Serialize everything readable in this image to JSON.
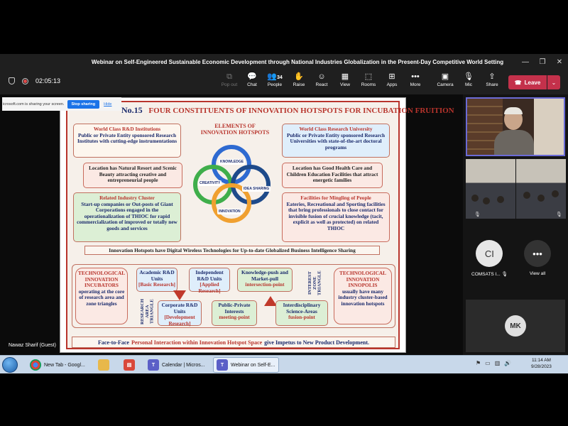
{
  "window": {
    "title": "Webinar on Self-Engineered Sustainable Economic Development through National Industries Globalization in the Present-Day Competitive World Setting"
  },
  "toolbar": {
    "timer": "02:05:13",
    "buttons": [
      {
        "label": "Pop out",
        "icon": "popout-icon"
      },
      {
        "label": "Chat",
        "icon": "chat-icon"
      },
      {
        "label": "People",
        "icon": "people-icon",
        "count": "34"
      },
      {
        "label": "Raise",
        "icon": "hand-icon"
      },
      {
        "label": "React",
        "icon": "smile-icon"
      },
      {
        "label": "View",
        "icon": "view-icon"
      },
      {
        "label": "Rooms",
        "icon": "rooms-icon"
      },
      {
        "label": "Apps",
        "icon": "apps-icon"
      },
      {
        "label": "More",
        "icon": "more-icon"
      },
      {
        "label": "Camera",
        "icon": "camera-off-icon"
      },
      {
        "label": "Mic",
        "icon": "mic-off-icon"
      },
      {
        "label": "Share",
        "icon": "share-icon"
      }
    ],
    "leave_label": "Leave"
  },
  "sharing": {
    "notice": "icrosoft.com is sharing your screen.",
    "stop_label": "Stop sharing",
    "hide_label": "Hide"
  },
  "presenter_name": "Nawaz Sharif (Guest)",
  "slide": {
    "number": "No.15",
    "title": "FOUR CONSTITUENTS OF INNOVATION HOTSPOTS FOR INCUBATION FRUITION",
    "elements_title": "ELEMENTS OF INNOVATION HOTSPOTS",
    "circle_labels": {
      "knowledge": "KNOWLEDGE",
      "creativity": "CREATIVITY",
      "idea_sharing": "IDEA SHARING",
      "innovation": "INNOVATION"
    },
    "box_tl_head": "World Class R&D Institutions",
    "box_tl_body": "Public or Private Entity sponsored Research Institutes with cutting-edge instrumentations",
    "box_tr_head": "World Class Research University",
    "box_tr_body": "Public or Private Entity sponsored Research Universities with state-of-the-art doctoral programs",
    "box_ml": "Location has Natural Resort and Scenic Beauty attracting creative and entrepreneurial people",
    "box_mr": "Location has Good Health Care and Children Education Facilities that attract energetic families",
    "box_bl_head": "Related Industry Cluster",
    "box_bl_body": "Start-up companies or Out-posts of Giant Corporations engaged in the operationalization of THIOC for rapid commercialization of improved or totally new goods and services",
    "box_br_head": "Facilities for Mingling of People",
    "box_br_body": "Eateries, Recreational and Sporting facilities that bring professionals to close contact for invisible fusion of crucial knowledge (tacit, explicit as well as protected) on related THIOC",
    "banner": "Innovation Hotspots have Digital Wireless Technologies for Up-to-date Globalized Business Intelligence Sharing",
    "incubators_head": "TECHNOLOGICAL INNOVATION INCUBATORS",
    "incubators_body": "operating at the core of research area and zone triangles",
    "academic_head": "Academic R&D Units",
    "academic_sub": "[Basic Research]",
    "independent_head": "Independent R&D Units",
    "independent_sub": "[Applied Research]",
    "corporate_head": "Corporate R&D Units",
    "corporate_sub": "[Development Research]",
    "research_triangle": "RESEARCH AREA TRIANGLE",
    "knowledge_push_head": "Knowledge-push and Market-pull",
    "knowledge_push_sub": "intersection-point",
    "public_private_head": "Public-Private Interests",
    "public_private_sub": "meeting-point",
    "interdisciplinary_head": "Interdisciplinary Science-Areas",
    "interdisciplinary_sub": "fusion-point",
    "interest_triangle": "INTEREST ZONE TRIANGLE",
    "innopolis_head": "TECHNOLOGICAL INNOVATION INNOPOLIS",
    "innopolis_body": "usually have many industry cluster-based innovation hotspots",
    "footer_a": "Face-to-Face",
    "footer_b": "Personal Interaction within Innovation Hotspot Space",
    "footer_c": "give Impetus to New Product Development."
  },
  "participants": {
    "ci_initials": "CI",
    "ci_name": "COMSATS I...",
    "view_all": "View all",
    "mk_initials": "MK"
  },
  "taskbar": {
    "items": [
      {
        "label": "New Tab - Googl..."
      },
      {
        "label": "Calendar | Micros..."
      },
      {
        "label": "Webinar on Self-E..."
      }
    ],
    "time": "11:14 AM",
    "date": "9/28/2023"
  },
  "colors": {
    "accent_red": "#b8342c",
    "navy": "#1a2a6c",
    "leave_red": "#c4314b",
    "teams_bar": "#1f1f1f"
  }
}
